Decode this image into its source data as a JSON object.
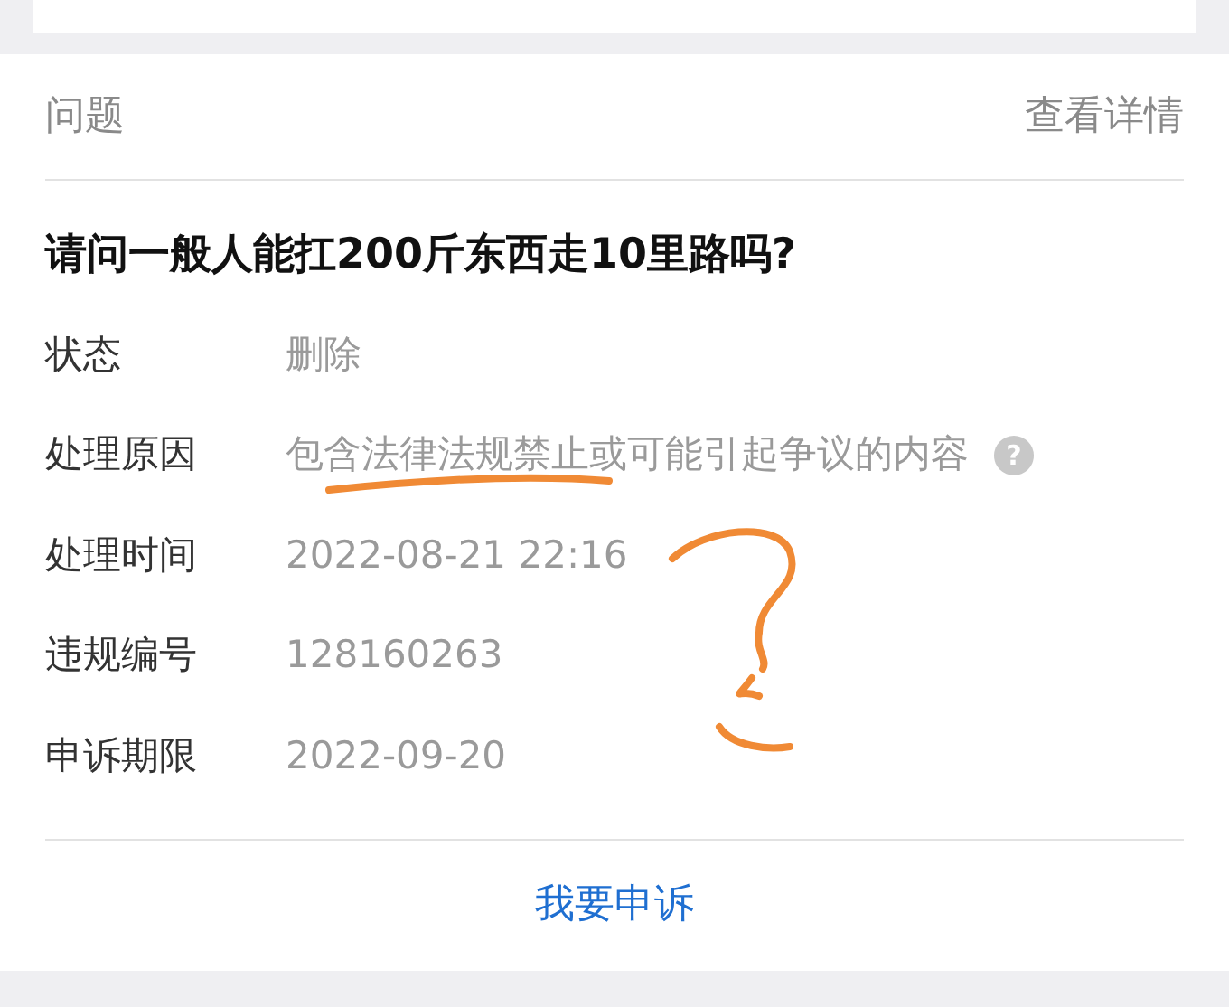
{
  "header": {
    "title": "问题",
    "link": "查看详情"
  },
  "question": "请问一般人能扛200斤东西走10里路吗?",
  "rows": [
    {
      "label": "状态",
      "value": "删除"
    },
    {
      "label": "处理原因",
      "value": "包含法律法规禁止或可能引起争议的内容",
      "help": "?"
    },
    {
      "label": "处理时间",
      "value": "2022-08-21 22:16"
    },
    {
      "label": "违规编号",
      "value": "128160263"
    },
    {
      "label": "申诉期限",
      "value": "2022-09-20"
    }
  ],
  "action": "我要申诉"
}
